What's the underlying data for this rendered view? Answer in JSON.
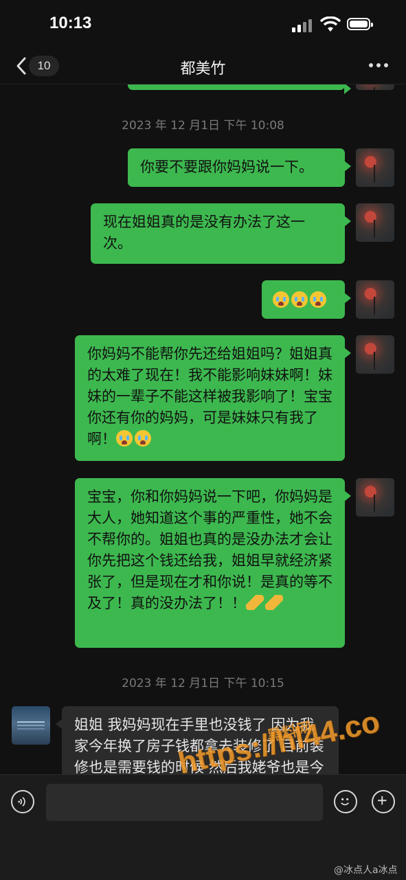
{
  "status_bar": {
    "time": "10:13"
  },
  "nav": {
    "unread_count": "10",
    "title": "都美竹"
  },
  "messages": [
    {
      "type": "timestamp",
      "text": "2023 年 12 月1日  下午 10:08"
    },
    {
      "type": "sent",
      "text": "你要不要跟你妈妈说一下。"
    },
    {
      "type": "sent",
      "text": "现在姐姐真的是没有办法了这一次。"
    },
    {
      "type": "sent",
      "text": "",
      "emoji": [
        "crying-face",
        "crying-face",
        "crying-face"
      ]
    },
    {
      "type": "sent",
      "text": "你妈妈不能帮你先还给姐姐吗？姐姐真的太难了现在！我不能影响妹妹啊！妹妹的一辈子不能这样被我影响了！宝宝你还有你的妈妈，可是妹妹只有我了啊！",
      "emoji": [
        "crying-face",
        "crying-face"
      ]
    },
    {
      "type": "sent",
      "text": "宝宝，你和你妈妈说一下吧，你妈妈是大人，她知道这个事的严重性，她不会不帮你的。姐姐也真的是没办法才会让你先把这个钱还给我，姐姐早就经济紧张了，但是现在才和你说！是真的等不及了！真的没办法了！！",
      "emoji": [
        "folded-hands",
        "folded-hands"
      ]
    },
    {
      "type": "timestamp",
      "text": "2023 年 12 月1日  下午 10:15"
    },
    {
      "type": "received",
      "text": "姐姐 我妈妈现在手里也没钱了 因为我家今年换了房子钱都拿去装修了 目前装修也是需要钱的时候 然后我姥爷也是今年没的 买墓地也花了很"
    }
  ],
  "watermark": {
    "text": "https://hl44.co",
    "small": "黑料网"
  },
  "credit": "@冰点人a冰点",
  "colors": {
    "sent_bubble": "#3db84f",
    "received_bubble": "#2b2b2b",
    "background": "#111111",
    "watermark": "#f39c2c"
  }
}
